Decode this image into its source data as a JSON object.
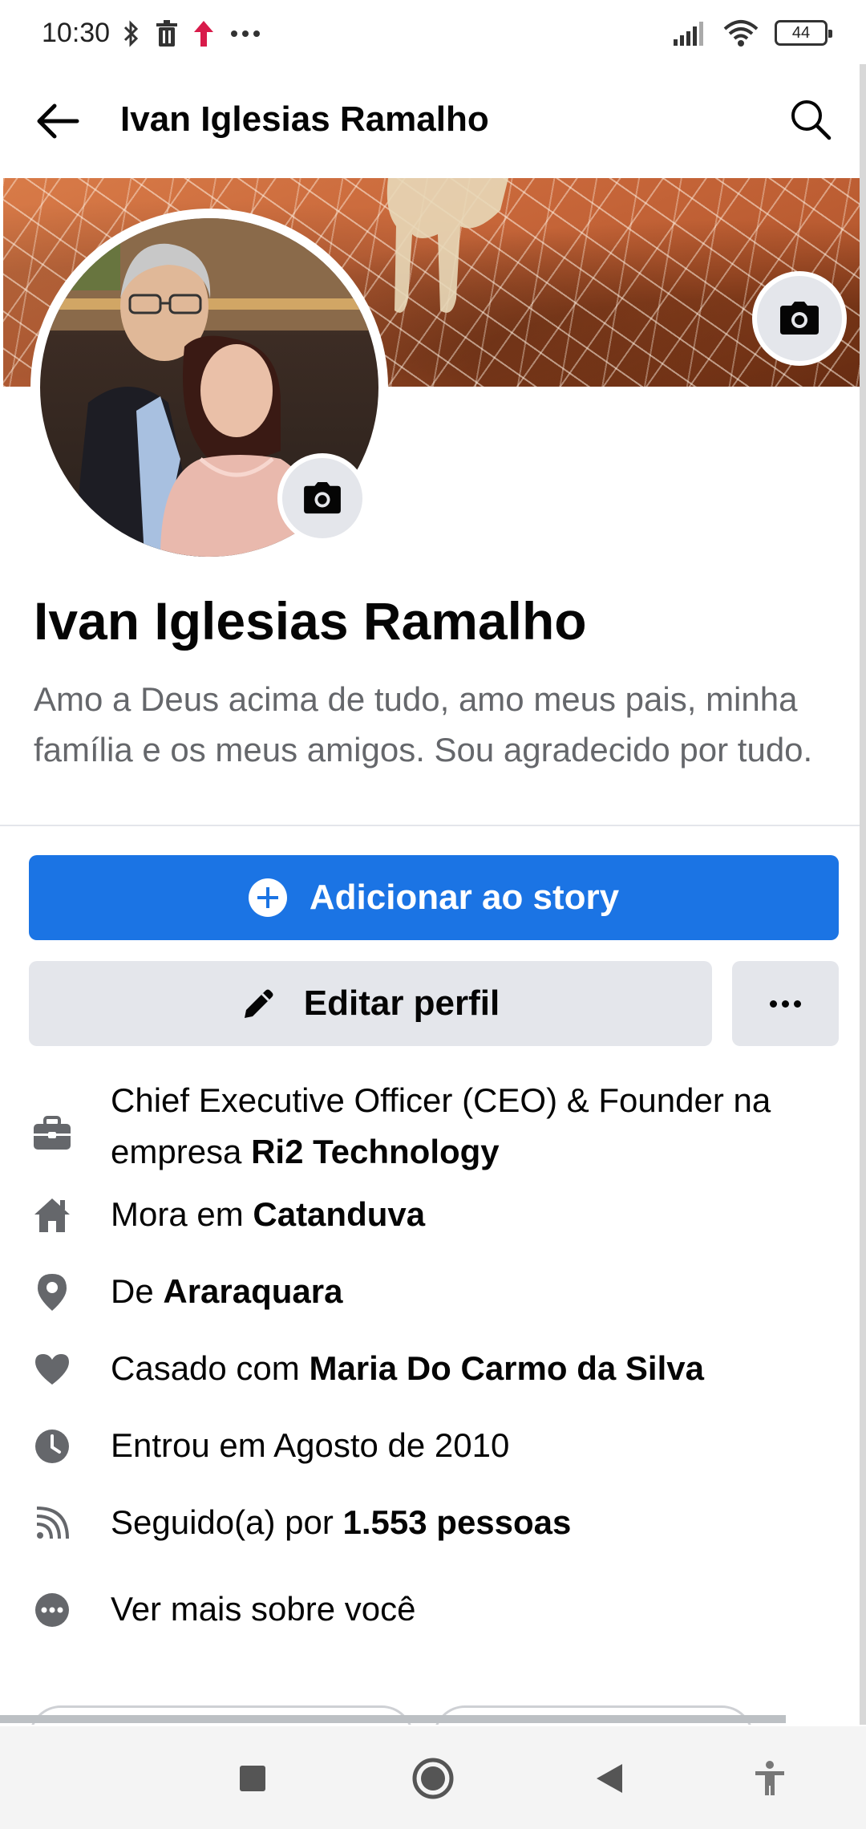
{
  "status_bar": {
    "time": "10:30",
    "battery": "44",
    "left_icons": [
      "bluetooth-icon",
      "trash-icon",
      "upload-arrow-icon",
      "more-dots-icon"
    ],
    "right_icons": [
      "signal-icon",
      "wifi-icon",
      "battery-icon"
    ]
  },
  "header": {
    "title": "Ivan Iglesias Ramalho"
  },
  "profile": {
    "name": "Ivan Iglesias Ramalho",
    "bio": "Amo a Deus acima de tudo, amo meus pais, minha família e os meus amigos. Sou agradecido por tudo."
  },
  "actions": {
    "story_label": "Adicionar ao story",
    "edit_label": "Editar perfil"
  },
  "details": {
    "work_prefix": "Chief Executive Officer (CEO) & Founder na empresa ",
    "work_company": "Ri2 Technology",
    "lives_prefix": "Mora em ",
    "lives_city": "Catanduva",
    "from_prefix": "De ",
    "from_city": "Araraquara",
    "relationship_prefix": "Casado com ",
    "relationship_partner": "Maria Do Carmo da Silva",
    "joined": "Entrou em Agosto de 2010",
    "followers_prefix": "Seguido(a) por ",
    "followers_count": "1.553 pessoas",
    "see_more": "Ver mais sobre você"
  },
  "colors": {
    "primary_blue": "#1b74e4",
    "secondary_button": "#e4e6eb",
    "text_primary": "#050505",
    "text_secondary": "#65676b"
  }
}
